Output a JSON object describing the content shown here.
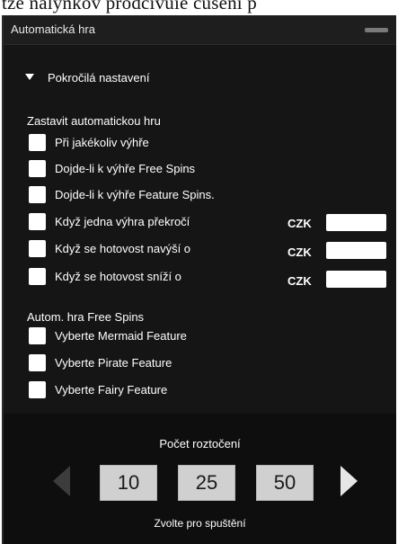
{
  "top_text": "tze nalynkov prodcivuie cuseni p",
  "window": {
    "title": "Automatická hra"
  },
  "advanced": {
    "label": "Pokročilá nastavení"
  },
  "stop_section": {
    "label": "Zastavit automatickou hru",
    "options": [
      "Při jakékoliv výhře",
      "Dojde-li k výhře Free Spins",
      "Dojde-li k výhře Feature Spins.",
      "Když jedna výhra překročí",
      "Když se hotovost navýší o",
      "Když se hotovost sníží o"
    ],
    "currency": "CZK"
  },
  "free_spins_section": {
    "label": "Autom. hra Free Spins",
    "options": [
      "Vyberte Mermaid Feature",
      "Vyberte Pirate Feature",
      "Vyberte Fairy Feature"
    ]
  },
  "spins": {
    "title": "Počet roztočení",
    "options": [
      "10",
      "25",
      "50"
    ],
    "hint": "Zvolte pro spuštění"
  },
  "icons": {
    "left": "arrow-left-icon",
    "right": "arrow-right-icon",
    "expand": "triangle-down-icon"
  }
}
